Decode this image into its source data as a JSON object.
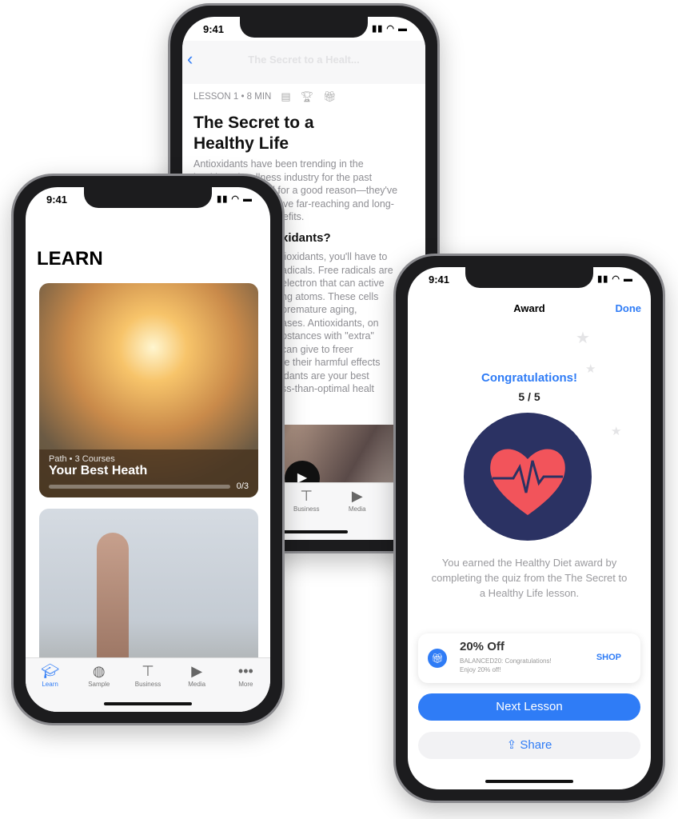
{
  "status_time": "9:41",
  "lesson_phone": {
    "nav_title": "The Secret to a Healt...",
    "meta": "LESSON 1 • 8 MIN",
    "title": "The Secret to a Healthy Life",
    "intro_lines": [
      "Antioxidants have been trending in the",
      "health and wellness industry for the past",
      "d for a good reason—they've",
      "ave far-reaching and long-",
      "efits."
    ],
    "heading": "xidants?",
    "body_lines": [
      "tioxidants, you'll have to",
      "adicals. Free radicals are",
      "electron that can active",
      "ng atoms. These cells",
      "premature aging,",
      "ases. Antioxidants, on",
      "bstances with \"extra\"",
      "can give to freer",
      "te their harmful effects",
      "idants are your best",
      "ss-than-optimal healt"
    ],
    "tabs": [
      {
        "label": "Business",
        "icon": "hierarchy-icon"
      },
      {
        "label": "Media",
        "icon": "play-icon"
      }
    ]
  },
  "learn_phone": {
    "title": "LEARN",
    "card": {
      "subtitle": "Path • 3 Courses",
      "title": "Your Best Heath",
      "progress": "0/3",
      "progress_value": 0
    },
    "tabs": [
      {
        "label": "Learn",
        "icon": "graduation-cap-icon",
        "active": true
      },
      {
        "label": "Sample",
        "icon": "globe-icon"
      },
      {
        "label": "Business",
        "icon": "hierarchy-icon"
      },
      {
        "label": "Media",
        "icon": "play-icon"
      },
      {
        "label": "More",
        "icon": "more-icon"
      }
    ]
  },
  "award_phone": {
    "nav_title": "Award",
    "done": "Done",
    "congrats": "Congratulations!",
    "score": "5 / 5",
    "description": "You earned the Healthy Diet award by completing the quiz from the The Secret to a Healthy Life lesson.",
    "coupon": {
      "title": "20% Off",
      "text": "BALANCED20: Congratulations! Enjoy 20% off!",
      "action": "SHOP"
    },
    "next": "Next Lesson",
    "share": "Share"
  },
  "colors": {
    "accent": "#2f7cf6",
    "award_circle": "#2b3263",
    "heart": "#f2545b"
  }
}
